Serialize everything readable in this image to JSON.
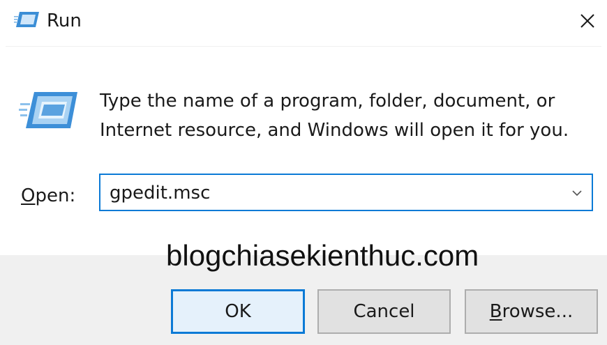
{
  "window": {
    "title": "Run",
    "icon": "run-icon",
    "close_icon": "close-icon"
  },
  "dialog": {
    "description_line1": "Type the name of a program, folder, document, or",
    "description_line2": "Internet resource, and Windows will open it for you.",
    "open_label_access": "O",
    "open_label_rest": "pen:",
    "open_value": "gpedit.msc"
  },
  "watermark": "blogchiasekienthuc.com",
  "buttons": {
    "ok": "OK",
    "cancel": "Cancel",
    "browse_access": "B",
    "browse_rest": "rowse..."
  },
  "colors": {
    "accent": "#0b7ad6",
    "footer_bg": "#f0f0f0",
    "button_bg": "#e1e1e1"
  }
}
